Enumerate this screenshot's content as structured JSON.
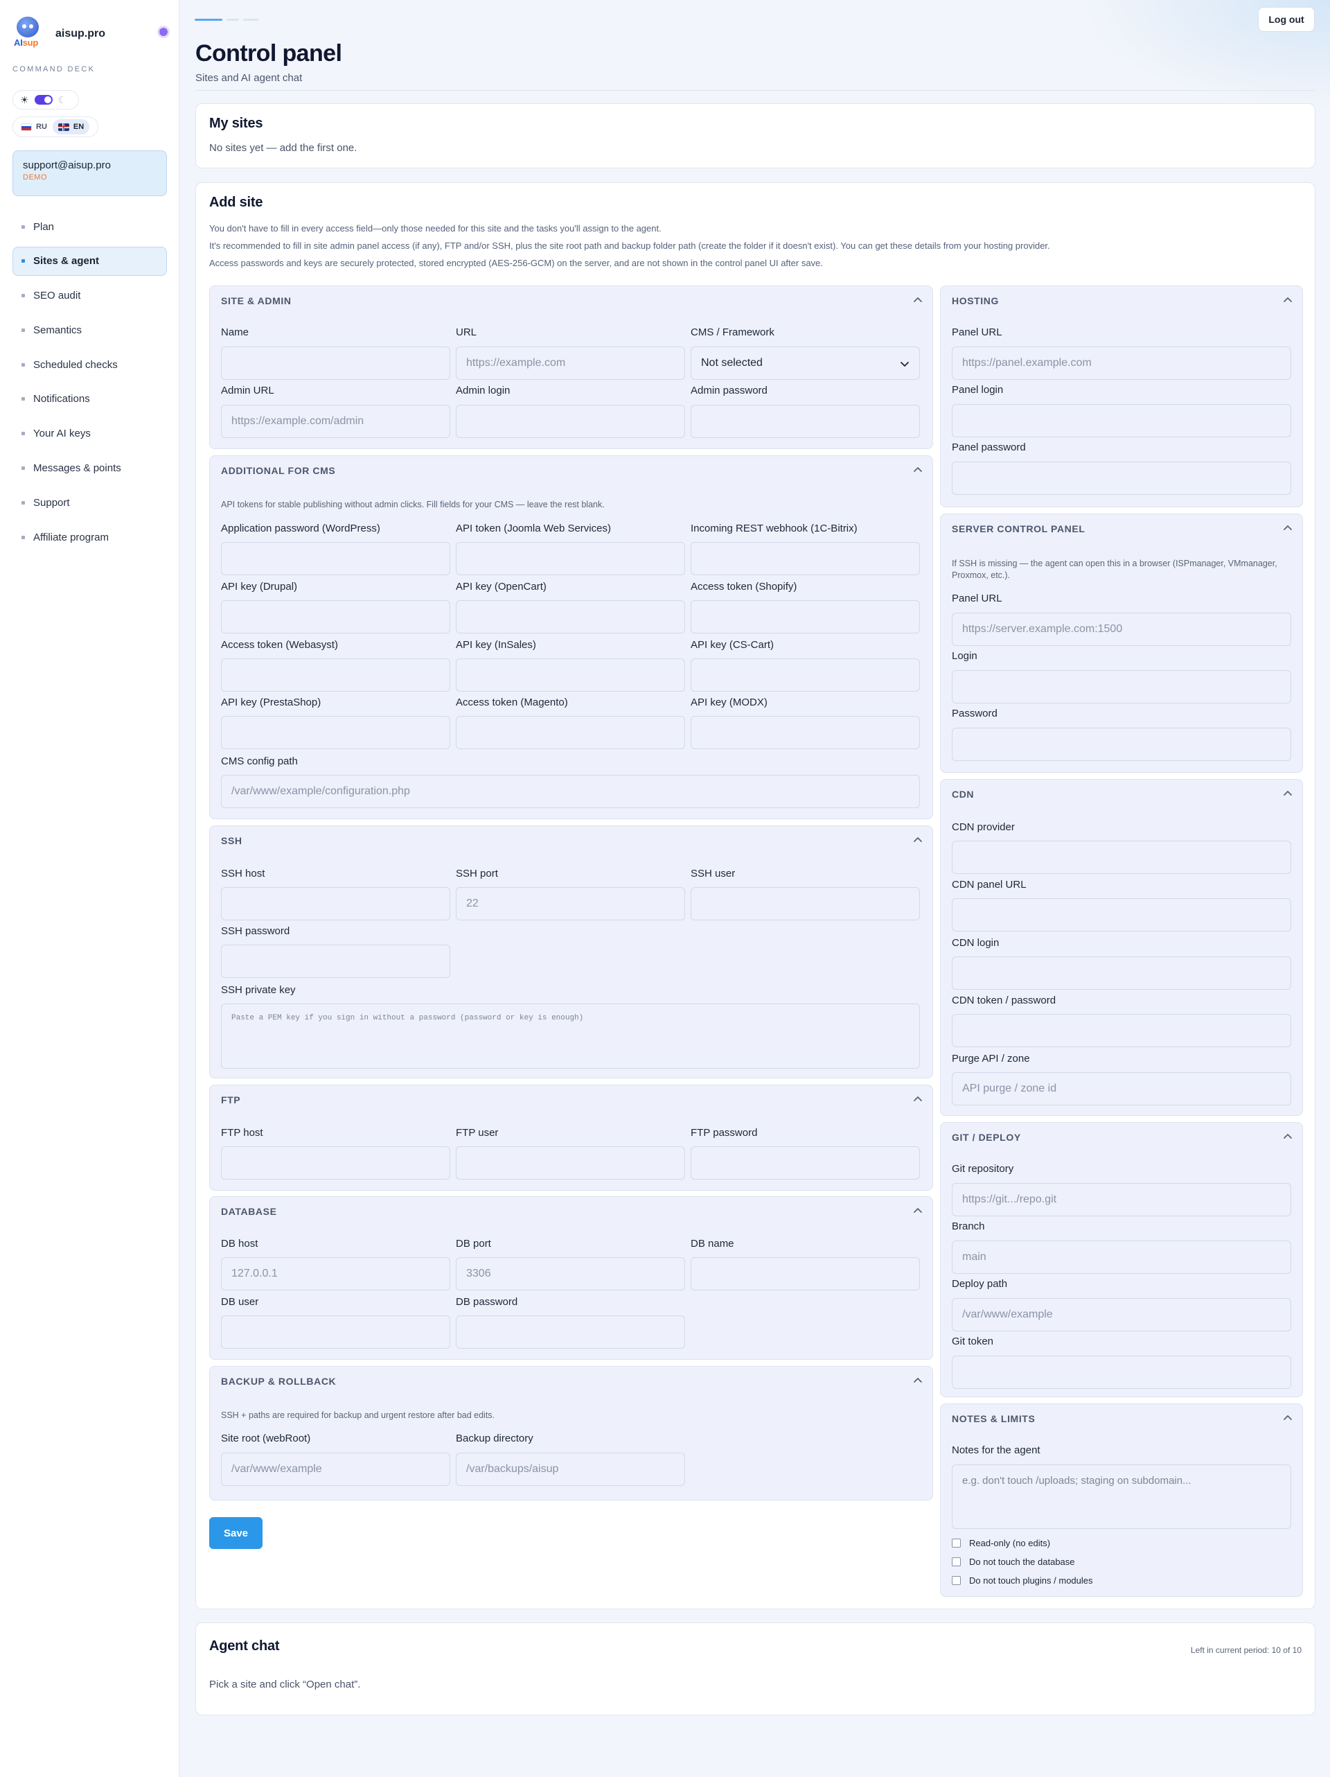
{
  "sidebar": {
    "brand_name": "aisup.pro",
    "logo_ai": "AI",
    "logo_sup": "sup",
    "section_label": "COMMAND DECK",
    "theme_icons": [
      "sun-icon",
      "moon-icon"
    ],
    "langs": [
      {
        "code": "RU",
        "active": false
      },
      {
        "code": "EN",
        "active": true
      }
    ],
    "account_email": "support@aisup.pro",
    "account_plan": "DEMO",
    "nav": [
      {
        "label": "Plan",
        "active": false
      },
      {
        "label": "Sites & agent",
        "active": true
      },
      {
        "label": "SEO audit",
        "active": false
      },
      {
        "label": "Semantics",
        "active": false
      },
      {
        "label": "Scheduled checks",
        "active": false
      },
      {
        "label": "Notifications",
        "active": false
      },
      {
        "label": "Your AI keys",
        "active": false
      },
      {
        "label": "Messages & points",
        "active": false
      },
      {
        "label": "Support",
        "active": false
      },
      {
        "label": "Affiliate program",
        "active": false
      }
    ]
  },
  "header": {
    "logout_label": "Log out",
    "title": "Control panel",
    "subtitle": "Sites and AI agent chat"
  },
  "my_sites": {
    "title": "My sites",
    "empty_text": "No sites yet — add the first one."
  },
  "add_site": {
    "title": "Add site",
    "notes": [
      "You don't have to fill in every access field—only those needed for this site and the tasks you'll assign to the agent.",
      "It's recommended to fill in site admin panel access (if any), FTP and/or SSH, plus the site root path and backup folder path (create the folder if it doesn't exist). You can get these details from your hosting provider.",
      "Access passwords and keys are securely protected, stored encrypted (AES-256-GCM) on the server, and are not shown in the control panel UI after save."
    ],
    "save_label": "Save",
    "site_admin": {
      "heading": "SITE & ADMIN",
      "name_label": "Name",
      "url_label": "URL",
      "url_placeholder": "https://example.com",
      "cms_label": "CMS / Framework",
      "cms_value": "Not selected",
      "admin_url_label": "Admin URL",
      "admin_url_placeholder": "https://example.com/admin",
      "admin_login_label": "Admin login",
      "admin_password_label": "Admin password"
    },
    "additional_cms": {
      "heading": "ADDITIONAL FOR CMS",
      "description": "API tokens for stable publishing without admin clicks. Fill fields for your CMS — leave the rest blank.",
      "fields": [
        "Application password (WordPress)",
        "API token (Joomla Web Services)",
        "Incoming REST webhook (1C-Bitrix)",
        "API key (Drupal)",
        "API key (OpenCart)",
        "Access token (Shopify)",
        "Access token (Webasyst)",
        "API key (InSales)",
        "API key (CS-Cart)",
        "API key (PrestaShop)",
        "Access token (Magento)",
        "API key (MODX)"
      ],
      "config_path_label": "CMS config path",
      "config_path_placeholder": "/var/www/example/configuration.php"
    },
    "ssh": {
      "heading": "SSH",
      "host_label": "SSH host",
      "port_label": "SSH port",
      "port_placeholder": "22",
      "user_label": "SSH user",
      "password_label": "SSH password",
      "key_label": "SSH private key",
      "key_placeholder": "Paste a PEM key if you sign in without a password (password or key is enough)"
    },
    "ftp": {
      "heading": "FTP",
      "host_label": "FTP host",
      "user_label": "FTP user",
      "password_label": "FTP password"
    },
    "database": {
      "heading": "DATABASE",
      "host_label": "DB host",
      "host_placeholder": "127.0.0.1",
      "port_label": "DB port",
      "port_placeholder": "3306",
      "name_label": "DB name",
      "user_label": "DB user",
      "password_label": "DB password"
    },
    "backup": {
      "heading": "BACKUP & ROLLBACK",
      "description": "SSH + paths are required for backup and urgent restore after bad edits.",
      "root_label": "Site root (webRoot)",
      "root_placeholder": "/var/www/example",
      "backup_label": "Backup directory",
      "backup_placeholder": "/var/backups/aisup"
    },
    "hosting": {
      "heading": "HOSTING",
      "panel_url_label": "Panel URL",
      "panel_url_placeholder": "https://panel.example.com",
      "panel_login_label": "Panel login",
      "panel_password_label": "Panel password"
    },
    "server_panel": {
      "heading": "SERVER CONTROL PANEL",
      "description": "If SSH is missing — the agent can open this in a browser (ISPmanager, VMmanager, Proxmox, etc.).",
      "url_label": "Panel URL",
      "url_placeholder": "https://server.example.com:1500",
      "login_label": "Login",
      "password_label": "Password"
    },
    "cdn": {
      "heading": "CDN",
      "provider_label": "CDN provider",
      "panel_url_label": "CDN panel URL",
      "login_label": "CDN login",
      "token_label": "CDN token / password",
      "purge_label": "Purge API / zone",
      "purge_placeholder": "API purge / zone id"
    },
    "git": {
      "heading": "GIT / DEPLOY",
      "repo_label": "Git repository",
      "repo_placeholder": "https://git.../repo.git",
      "branch_label": "Branch",
      "branch_placeholder": "main",
      "deploy_path_label": "Deploy path",
      "deploy_path_placeholder": "/var/www/example",
      "token_label": "Git token"
    },
    "notes_limits": {
      "heading": "NOTES & LIMITS",
      "notes_label": "Notes for the agent",
      "notes_placeholder": "e.g. don't touch /uploads; staging on subdomain...",
      "checkboxes": [
        "Read-only (no edits)",
        "Do not touch the database",
        "Do not touch plugins / modules"
      ]
    }
  },
  "agent_chat": {
    "title": "Agent chat",
    "usage": "Left in current period: 10 of 10",
    "empty_text": "Pick a site and click “Open chat”."
  }
}
